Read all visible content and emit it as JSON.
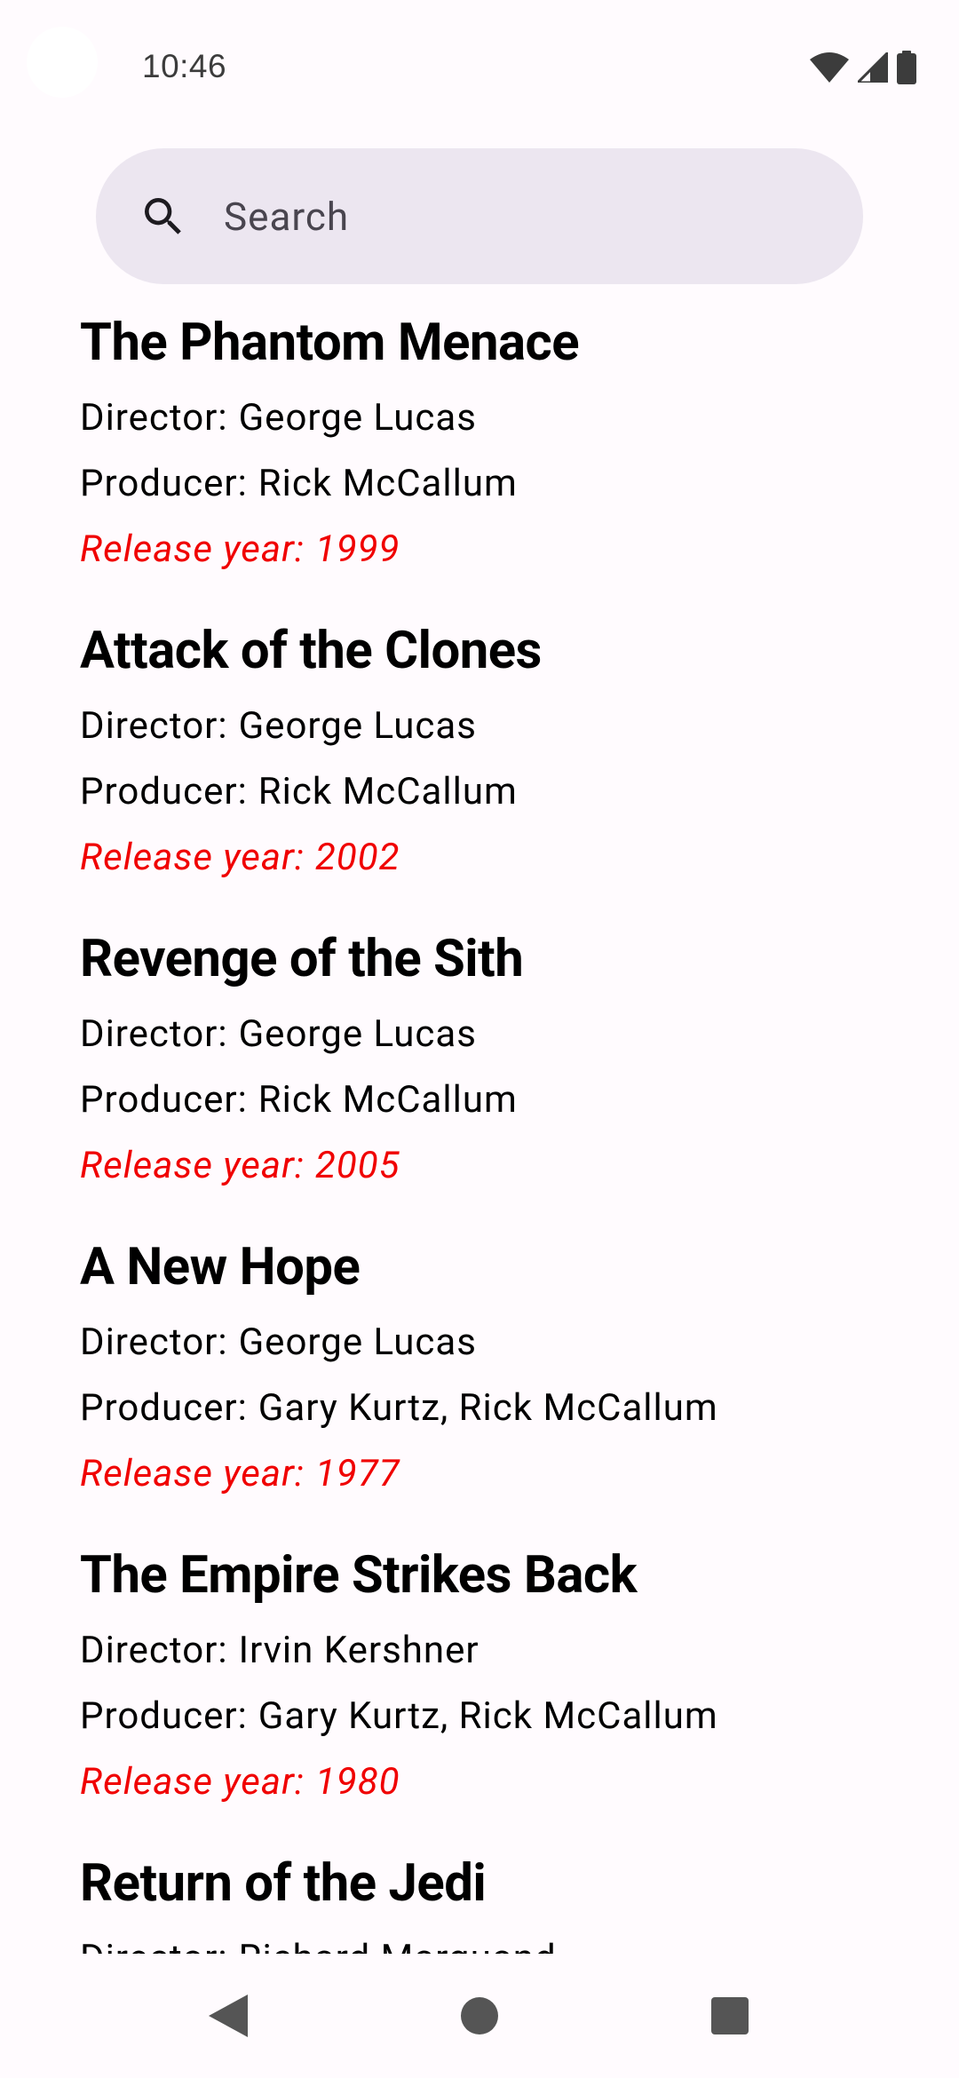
{
  "status_bar": {
    "time": "10:46"
  },
  "search": {
    "placeholder": "Search",
    "icon": "search-icon"
  },
  "labels": {
    "director": "Director:",
    "producer": "Producer:",
    "release_year": "Release year:"
  },
  "movies": [
    {
      "title": "The Phantom Menace",
      "director": "George Lucas",
      "producer": "Rick McCallum",
      "release_year": "1999"
    },
    {
      "title": "Attack of the Clones",
      "director": "George Lucas",
      "producer": "Rick McCallum",
      "release_year": "2002"
    },
    {
      "title": "Revenge of the Sith",
      "director": "George Lucas",
      "producer": "Rick McCallum",
      "release_year": "2005"
    },
    {
      "title": "A New Hope",
      "director": "George Lucas",
      "producer": "Gary Kurtz, Rick McCallum",
      "release_year": "1977"
    },
    {
      "title": "The Empire Strikes Back",
      "director": "Irvin Kershner",
      "producer": "Gary Kurtz, Rick McCallum",
      "release_year": "1980"
    },
    {
      "title": "Return of the Jedi",
      "director": "Richard Marquand",
      "producer": "",
      "release_year": ""
    }
  ],
  "colors": {
    "background": "#fffbfe",
    "search_background": "#ece6f0",
    "release_year": "#f00000"
  },
  "nav_bar": {
    "back_icon": "back-triangle-icon",
    "home_icon": "home-circle-icon",
    "recents_icon": "recents-square-icon"
  }
}
